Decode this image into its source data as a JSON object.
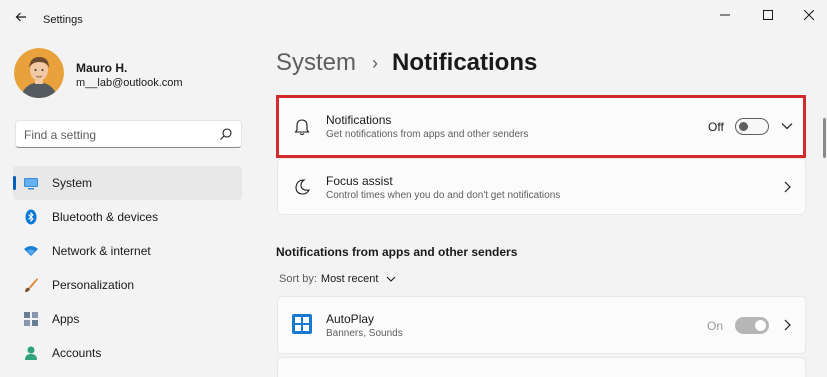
{
  "window": {
    "title": "Settings",
    "back_icon": "arrow-left-icon",
    "minimize_icon": "minimize-icon",
    "maximize_icon": "maximize-icon",
    "close_icon": "close-icon"
  },
  "profile": {
    "name": "Mauro H.",
    "email": "m__lab@outlook.com"
  },
  "search": {
    "placeholder": "Find a setting",
    "value": "",
    "icon": "search-icon"
  },
  "sidebar": {
    "items": [
      {
        "label": "System",
        "icon": "system-icon",
        "active": true
      },
      {
        "label": "Bluetooth & devices",
        "icon": "bluetooth-icon"
      },
      {
        "label": "Network & internet",
        "icon": "wifi-icon"
      },
      {
        "label": "Personalization",
        "icon": "brush-icon"
      },
      {
        "label": "Apps",
        "icon": "apps-icon"
      },
      {
        "label": "Accounts",
        "icon": "person-icon"
      }
    ]
  },
  "breadcrumb": {
    "parent": "System",
    "separator": "›",
    "current": "Notifications"
  },
  "notifications_card": {
    "title": "Notifications",
    "description": "Get notifications from apps and other senders",
    "state_label": "Off",
    "toggle_on": false,
    "icon": "bell-icon",
    "expand_icon": "chevron-down-icon"
  },
  "focus_card": {
    "title": "Focus assist",
    "description": "Control times when you do and don't get notifications",
    "icon": "moon-icon"
  },
  "apps_section": {
    "title": "Notifications from apps and other senders",
    "sort_label": "Sort by:",
    "sort_value": "Most recent",
    "items": [
      {
        "title": "AutoPlay",
        "description": "Banners, Sounds",
        "state_label": "On",
        "toggle_on": true,
        "disabled": true,
        "icon": "autoplay-icon"
      }
    ]
  },
  "colors": {
    "accent": "#005fb8",
    "highlight_border": "#d12b2e"
  }
}
